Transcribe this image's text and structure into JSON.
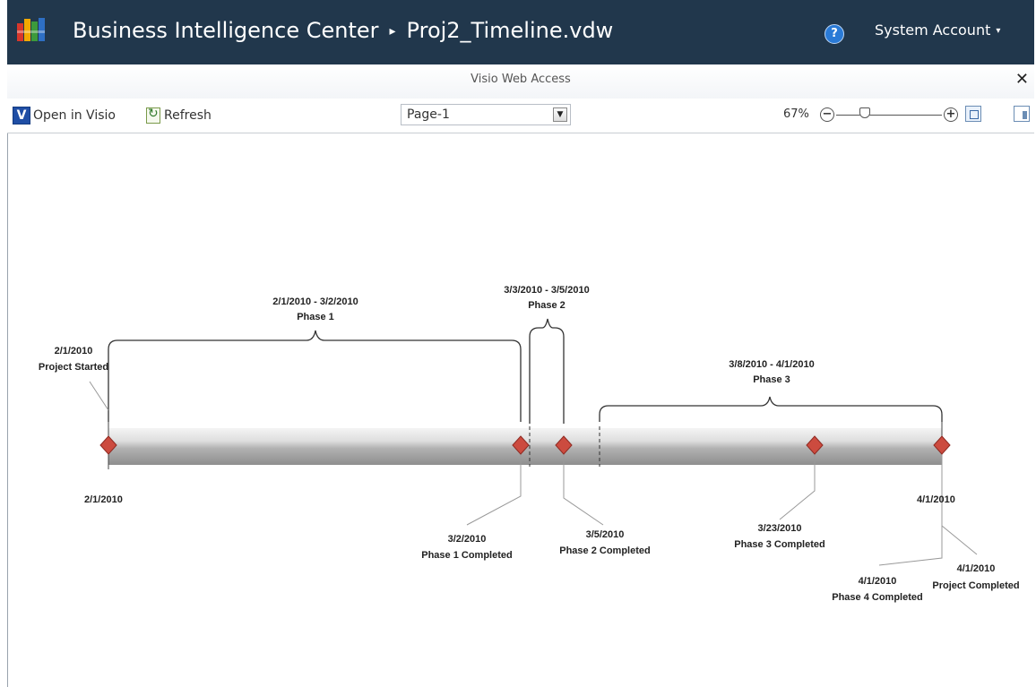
{
  "header": {
    "site_title": "Business Intelligence Center",
    "separator": "▸",
    "document_name": "Proj2_Timeline.vdw",
    "help_icon": "question-mark-icon",
    "account": "System Account",
    "account_caret": "▾"
  },
  "webpart": {
    "title": "Visio Web Access",
    "close_glyph": "✕"
  },
  "toolbar": {
    "open_in_visio_label": "Open in Visio",
    "refresh_label": "Refresh",
    "page_select_value": "Page-1",
    "zoom_level": "67%",
    "zoom_minus": "−",
    "zoom_plus": "+",
    "zoom_fraction": 0.25
  },
  "timeline": {
    "start_label": "2/1/2010",
    "end_label": "4/1/2010",
    "intervals": [
      {
        "dates": "2/1/2010 - 3/2/2010",
        "name": "Phase 1"
      },
      {
        "dates": "3/3/2010 - 3/5/2010",
        "name": "Phase 2"
      },
      {
        "dates": "3/8/2010 - 4/1/2010",
        "name": "Phase 3"
      }
    ],
    "milestones": [
      {
        "date": "2/1/2010",
        "name": "Project Started"
      },
      {
        "date": "3/2/2010",
        "name": "Phase 1 Completed"
      },
      {
        "date": "3/5/2010",
        "name": "Phase 2 Completed"
      },
      {
        "date": "3/23/2010",
        "name": "Phase 3 Completed"
      },
      {
        "date": "4/1/2010",
        "name": "Phase 4 Completed"
      },
      {
        "date": "4/1/2010",
        "name": "Project Completed"
      }
    ]
  }
}
